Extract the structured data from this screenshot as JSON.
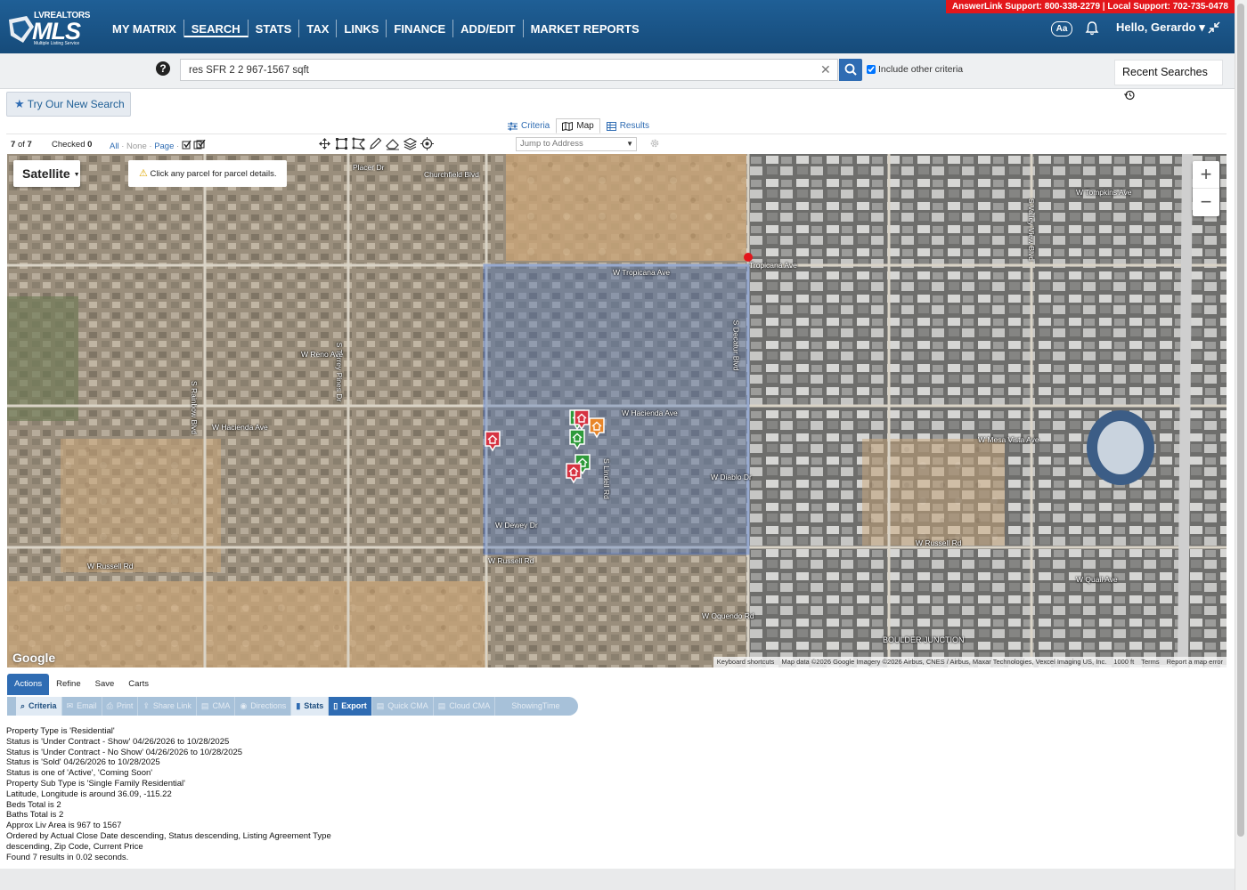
{
  "support_text": "AnswerLink Support: 800-338-2279 | Local Support: 702-735-0478",
  "logo": {
    "top": "LVREALTORS",
    "main": "MLS",
    "sub": "Multiple Listing Service"
  },
  "nav": [
    "MY MATRIX",
    "SEARCH",
    "STATS",
    "TAX",
    "LINKS",
    "FINANCE",
    "ADD/EDIT",
    "MARKET REPORTS"
  ],
  "header_right": {
    "aa": "Aa",
    "user": "Hello, Gerardo ▾"
  },
  "search": {
    "help": "?",
    "value": "res SFR 2 2 967-1567 sqft",
    "include_label": "Include other criteria",
    "recent": "Recent Searches"
  },
  "try_new": "Try Our New Search",
  "view_tabs": [
    "Criteria",
    "Map",
    "Results"
  ],
  "toolbar": {
    "count_a": "7",
    "count_of": "of",
    "count_b": "7",
    "checked_label": "Checked",
    "checked_count": "0",
    "all": "All",
    "none": "None",
    "page": "Page",
    "jump_placeholder": "Jump to Address"
  },
  "map": {
    "type_label": "Satellite",
    "hint": "Click any parcel for parcel details.",
    "zoom_in": "+",
    "zoom_out": "−",
    "google": "Google",
    "attribution": [
      "Keyboard shortcuts",
      "Map data ©2026 Google Imagery ©2026 Airbus, CNES / Airbus, Maxar Technologies, Vexcel Imaging US, Inc.",
      "1000 ft",
      "Terms",
      "Report a map error"
    ],
    "labels": {
      "tropicana1": "W Tropicana Ave",
      "tropicana2": "Tropicana Ave",
      "hacienda1": "W Hacienda Ave",
      "hacienda2": "W Hacienda Ave",
      "russell1": "W Russell Rd",
      "russell2": "W Russell Rd",
      "decatur": "S Decatur Blvd",
      "rainbow": "S Rainbow Blvd",
      "torrey": "S Torrey Pines Dr",
      "reno": "W Reno Ave",
      "diablo": "W Diablo Dr",
      "dewey": "W Dewey Dr",
      "quail": "W Quail Ave",
      "oquendo": "W Oquendo Rd",
      "valley": "S Valley View Blvd",
      "boulder": "BOULDER JUNCTION",
      "placer": "Placer Dr",
      "churchfield": "Churchfield Blvd",
      "tompkins": "W Tompkins Ave",
      "lindell": "S Lindell Rd",
      "mesa": "W Mesa Vista Ave",
      "russell3": "W Russell Rd"
    },
    "marker_colors": {
      "sold": "#d63342",
      "active": "#2e9a3a",
      "contract": "#e8862a"
    }
  },
  "actions_tabs": [
    "Actions",
    "Refine",
    "Save",
    "Carts"
  ],
  "action_items": [
    {
      "label": "Criteria",
      "icon": "search-icon",
      "state": "enabled-light"
    },
    {
      "label": "Email",
      "icon": "email-icon",
      "state": "disabled"
    },
    {
      "label": "Print",
      "icon": "print-icon",
      "state": "disabled"
    },
    {
      "label": "Share Link",
      "icon": "share-icon",
      "state": "disabled"
    },
    {
      "label": "CMA",
      "icon": "cma-icon",
      "state": "disabled"
    },
    {
      "label": "Directions",
      "icon": "directions-icon",
      "state": "disabled"
    },
    {
      "label": "Stats",
      "icon": "stats-icon",
      "state": "enabled-light"
    },
    {
      "label": "Export",
      "icon": "export-icon",
      "state": "enabled"
    },
    {
      "label": "Quick CMA",
      "icon": "quick-cma-icon",
      "state": "disabled"
    },
    {
      "label": "Cloud CMA",
      "icon": "cloud-cma-icon",
      "state": "disabled"
    },
    {
      "label": "ShowingTime",
      "icon": "",
      "state": "disabled"
    }
  ],
  "criteria_lines": [
    "Property Type is 'Residential'",
    "Status is 'Under Contract - Show' 04/26/2026 to 10/28/2025",
    "Status is 'Under Contract - No Show' 04/26/2026 to 10/28/2025",
    "Status is 'Sold' 04/26/2026 to 10/28/2025",
    "Status is one of 'Active', 'Coming Soon'",
    "Property Sub Type is 'Single Family Residential'",
    "Latitude, Longitude is around 36.09, -115.22",
    "Beds Total is 2",
    "Baths Total is 2",
    "Approx Liv Area is 967 to 1567",
    "Ordered by Actual Close Date descending, Status descending, Listing Agreement Type",
    "descending, Zip Code, Current Price",
    "Found 7 results in 0.02 seconds."
  ]
}
